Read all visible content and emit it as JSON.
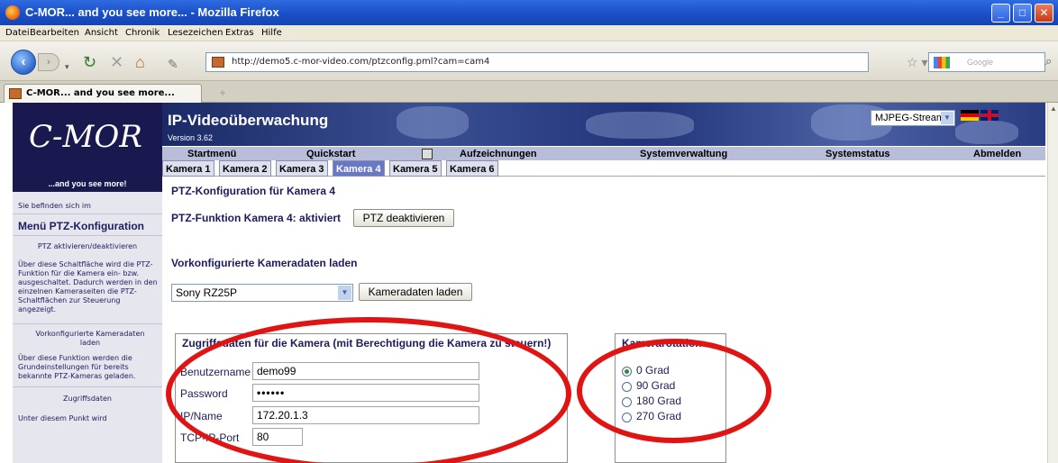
{
  "window": {
    "title": "C-MOR... and you see more... - Mozilla Firefox"
  },
  "menubar": [
    "Datei",
    "Bearbeiten",
    "Ansicht",
    "Chronik",
    "Lesezeichen",
    "Extras",
    "Hilfe"
  ],
  "navbar": {
    "url": "http://demo5.c-mor-video.com/ptzconfig.pml?cam=cam4",
    "search_placeholder": "Google"
  },
  "tab": {
    "title": "C-MOR... and you see more..."
  },
  "header": {
    "logo": "C-MOR",
    "tagline": "...and you see more!",
    "app_title": "IP-Videoüberwachung",
    "version": "Version 3.62",
    "stream_select": "MJPEG-Stream"
  },
  "mainmenu": [
    "Startmenü",
    "Quickstart",
    "Aufzeichnungen",
    "Systemverwaltung",
    "Systemstatus",
    "Abmelden"
  ],
  "cameras": [
    "Kamera 1",
    "Kamera 2",
    "Kamera 3",
    "Kamera 4",
    "Kamera 5",
    "Kamera 6"
  ],
  "sidebar": {
    "location": "Sie befinden sich im",
    "menu_title": "Menü PTZ-Konfiguration",
    "section1_title": "PTZ aktivieren/deaktivieren",
    "section1_text": "Über diese Schaltfläche wird die PTZ-Funktion für die Kamera ein- bzw. ausgeschaltet. Dadurch werden in den einzelnen Kameraseiten die PTZ-Schaltflächen zur Steuerung angezeigt.",
    "section2_title": "Vorkonfigurierte Kameradaten laden",
    "section2_text": "Über diese Funktion werden die Grundeinstellungen für bereits bekannte PTZ-Kameras geladen.",
    "section3_title": "Zugriffsdaten",
    "section3_text": "Unter diesem Punkt wird"
  },
  "content": {
    "page_title": "PTZ-Konfiguration für Kamera 4",
    "ptz_status": "PTZ-Funktion Kamera 4: aktiviert",
    "ptz_button": "PTZ deaktivieren",
    "preconf_title": "Vorkonfigurierte Kameradaten laden",
    "camera_model": "Sony RZ25P",
    "load_button": "Kameradaten laden",
    "access_legend": "Zugriffsdaten für die Kamera (mit Berechtigung die Kamera zu steuern!)",
    "fields": {
      "username_label": "Benutzername",
      "username_value": "demo99",
      "password_label": "Password",
      "password_value": "••••••",
      "ip_label": "IP/Name",
      "ip_value": "172.20.1.3",
      "port_label": "TCP-IP-Port",
      "port_value": "80"
    },
    "rotation_legend": "Kamerarotation",
    "rotation_options": [
      "0 Grad",
      "90 Grad",
      "180 Grad",
      "270 Grad"
    ],
    "rotation_selected": "0 Grad"
  },
  "colors": {
    "annotation": "#e11414",
    "active_tab": "#6978c6",
    "sidebar_bg": "#e6e6ee",
    "header_bg": "#19194f"
  }
}
